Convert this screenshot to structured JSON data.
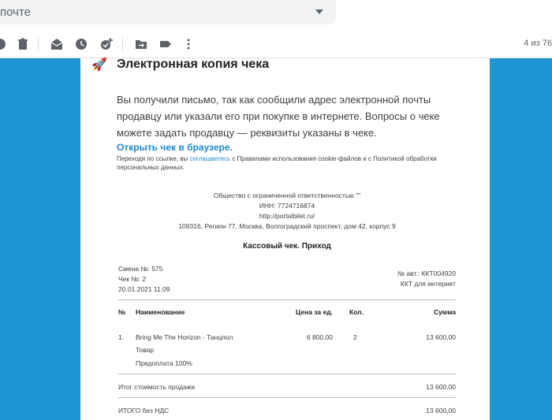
{
  "search": {
    "placeholder": "почте"
  },
  "toolbar": {
    "pager": "4 из 76"
  },
  "email": {
    "title": "Электронная копия чека",
    "body": "Вы получили письмо, так как сообщили адрес электронной почты продавцу или указали его при покупке в интернете. Вопросы о чеке можете задать продавцу — реквизиты указаны в чеке.",
    "open_link": "Открыть чек в браузере.",
    "note_pre": "Переходя по ссылке, вы ",
    "note_link": "соглашаетесь",
    "note_post": " с Правилами использования cookie-файлов и с Политикой обработки персональных данных."
  },
  "seller": {
    "name": "Общество с ограниченной ответственностью \"\"",
    "inn": "ИНН: 7724716874",
    "site": "http://portalbilet.ru/",
    "address": "109316, Регион 77, Москва, Волгоградский проспект, дом 42, корпус 9"
  },
  "receipt": {
    "title": "Кассовый чек. Приход",
    "shift": "Смена №: 575",
    "check_no": "Чек №: 2",
    "datetime": "20.01.2021 11:09",
    "kkt_no": "№ авт.: ККТ004920",
    "kkt_type": "ККТ для интернет",
    "headers": {
      "num": "№",
      "name": "Наименование",
      "price": "Цена за ед.",
      "qty": "Кол.",
      "sum": "Сумма"
    },
    "items": [
      {
        "num": "1.",
        "name": "Bring Me The Horizon - Танцпол",
        "type": "Товар",
        "payment": "Предоплата 100%",
        "price": "6 800,00",
        "qty": "2",
        "sum": "13 600,00"
      }
    ],
    "total_label": "Итог стоимость продажи",
    "total_value": "13 600,00",
    "vat_label": "ИТОГО без НДС",
    "vat_value": "13 600,00"
  }
}
